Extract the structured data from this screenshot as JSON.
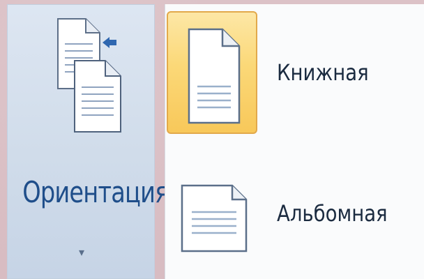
{
  "ribbon": {
    "label": "Ориентация",
    "arrow": "▾",
    "icon": "orientation-icon"
  },
  "menu": {
    "items": [
      {
        "label": "Книжная",
        "icon": "portrait-page-icon",
        "selected": true
      },
      {
        "label": "Альбомная",
        "icon": "landscape-page-icon",
        "selected": false
      }
    ]
  },
  "colors": {
    "background": "#dcc3c8",
    "ribbon_label": "#1f4e8a",
    "selected_fill": "#fbd877",
    "selected_border": "#e2a94b"
  }
}
